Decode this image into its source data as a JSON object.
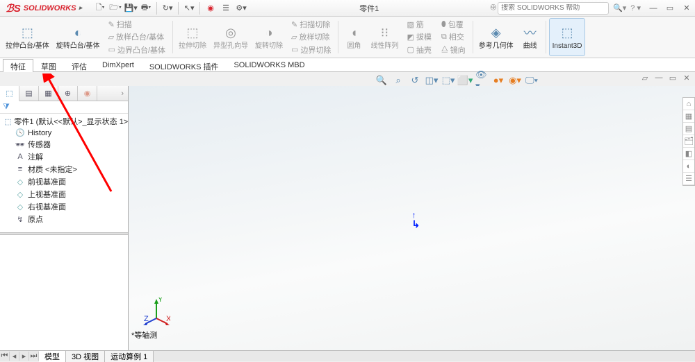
{
  "app": {
    "name": "SOLIDWORKS",
    "logo_ds": "DS"
  },
  "doc": {
    "title": "零件1"
  },
  "search": {
    "placeholder": "搜索 SOLIDWORKS 帮助"
  },
  "ribbon": {
    "extrude": "拉伸凸台/基体",
    "revolve": "旋转凸台/基体",
    "sweep": "扫描",
    "loft": "放样凸台/基体",
    "boundary": "边界凸台/基体",
    "extrude_cut": "拉伸切除",
    "wizard_hole": "异型孔向导",
    "revolve_cut": "旋转切除",
    "sweep_cut": "扫描切除",
    "loft_cut": "放样切除",
    "boundary_cut": "边界切除",
    "fillet": "圆角",
    "linear_pattern": "线性阵列",
    "rib": "筋",
    "draft": "拔模",
    "shell": "抽壳",
    "wrap": "包覆",
    "intersect": "相交",
    "mirror": "镜向",
    "ref_geom": "参考几何体",
    "curves": "曲线",
    "instant3d": "Instant3D"
  },
  "tabs": [
    "特征",
    "草图",
    "评估",
    "DimXpert",
    "SOLIDWORKS 插件",
    "SOLIDWORKS MBD"
  ],
  "active_tab_index": 0,
  "tree": {
    "root": "零件1 (默认<<默认>_显示状态 1>)",
    "items": [
      {
        "icon": "history",
        "label": "History"
      },
      {
        "icon": "sensor",
        "label": "传感器"
      },
      {
        "icon": "annot",
        "label": "注解"
      },
      {
        "icon": "material",
        "label": "材质 <未指定>"
      },
      {
        "icon": "plane",
        "label": "前视基准面"
      },
      {
        "icon": "plane",
        "label": "上视基准面"
      },
      {
        "icon": "plane",
        "label": "右视基准面"
      },
      {
        "icon": "origin",
        "label": "原点"
      }
    ]
  },
  "view_label": "*等轴测",
  "bottom_tabs": [
    "模型",
    "3D 视图",
    "运动算例 1"
  ],
  "active_bottom_tab_index": 0
}
